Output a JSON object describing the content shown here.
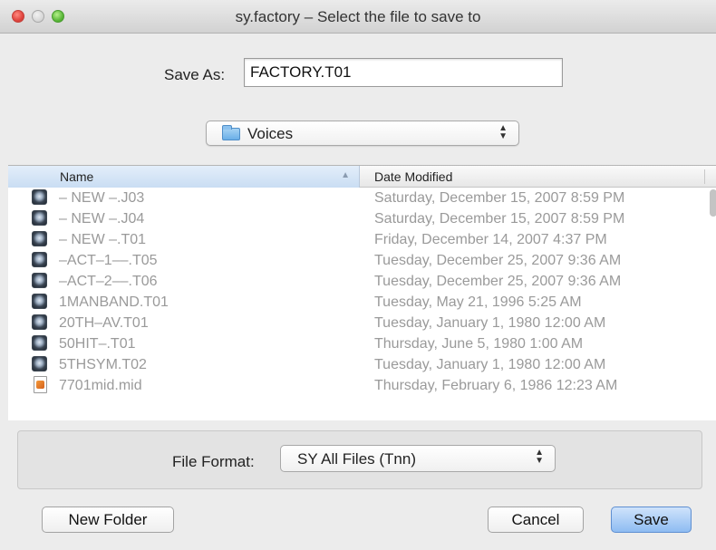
{
  "window": {
    "title": "sy.factory – Select the file to save to"
  },
  "save_as": {
    "label": "Save As:",
    "value": "FACTORY.T01"
  },
  "folder": {
    "name": "Voices"
  },
  "list": {
    "columns": {
      "name": "Name",
      "date": "Date Modified"
    },
    "files": [
      {
        "name": "– NEW –.J03",
        "date": "Saturday, December 15, 2007 8:59 PM",
        "icon": "disk-image-icon"
      },
      {
        "name": "– NEW –.J04",
        "date": "Saturday, December 15, 2007 8:59 PM",
        "icon": "disk-image-icon"
      },
      {
        "name": "– NEW –.T01",
        "date": "Friday, December 14, 2007 4:37 PM",
        "icon": "disk-image-icon"
      },
      {
        "name": "–ACT–1––.T05",
        "date": "Tuesday, December 25, 2007 9:36 AM",
        "icon": "disk-image-icon"
      },
      {
        "name": "–ACT–2––.T06",
        "date": "Tuesday, December 25, 2007 9:36 AM",
        "icon": "disk-image-icon"
      },
      {
        "name": "1MANBAND.T01",
        "date": "Tuesday, May 21, 1996 5:25 AM",
        "icon": "disk-image-icon"
      },
      {
        "name": "20TH–AV.T01",
        "date": "Tuesday, January 1, 1980 12:00 AM",
        "icon": "disk-image-icon"
      },
      {
        "name": "50HIT–.T01",
        "date": "Thursday, June 5, 1980 1:00 AM",
        "icon": "disk-image-icon"
      },
      {
        "name": "5THSYM.T02",
        "date": "Tuesday, January 1, 1980 12:00 AM",
        "icon": "disk-image-icon"
      },
      {
        "name": "7701mid.mid",
        "date": "Thursday, February 6, 1986 12:23 AM",
        "icon": "midi-file-icon"
      }
    ]
  },
  "file_format": {
    "label": "File Format:",
    "value": "SY All Files (Tnn)"
  },
  "buttons": {
    "new_folder": "New Folder",
    "cancel": "Cancel",
    "save": "Save"
  }
}
